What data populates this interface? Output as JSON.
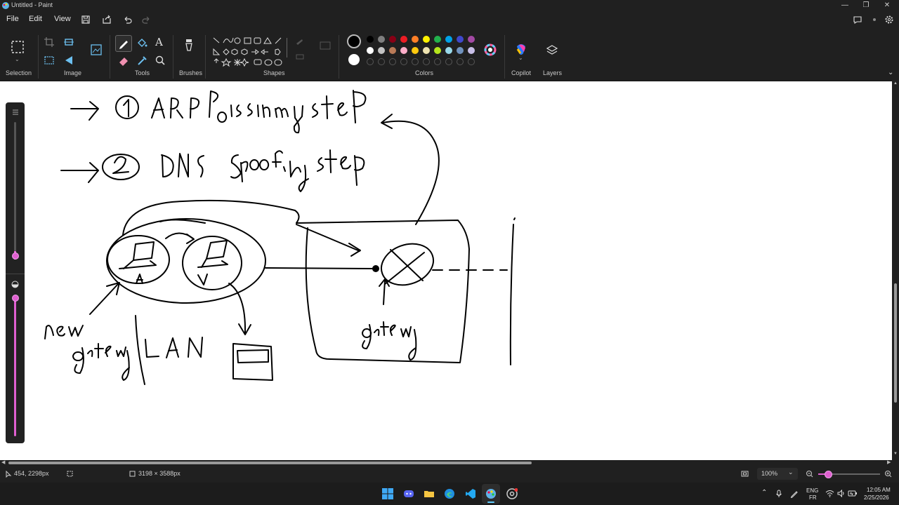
{
  "window": {
    "title": "Untitled - Paint",
    "controls": [
      "minimize-icon",
      "restore-icon",
      "close-icon"
    ]
  },
  "menu": {
    "items": [
      "File",
      "Edit",
      "View"
    ],
    "quick_actions": [
      "save-icon",
      "share-icon",
      "undo-icon",
      "redo-icon"
    ],
    "right_icons": [
      "feedback-icon",
      "account-icon",
      "settings-icon"
    ]
  },
  "ribbon": {
    "groups": {
      "selection": "Selection",
      "image": "Image",
      "tools": "Tools",
      "brushes": "Brushes",
      "shapes": "Shapes",
      "colors": "Colors",
      "copilot": "Copilot",
      "layers": "Layers"
    },
    "colors": {
      "primary": "#000000",
      "secondary": "#ffffff",
      "palette_row1": [
        "#000000",
        "#7f7f7f",
        "#880015",
        "#ed1c24",
        "#ff7f27",
        "#fff200",
        "#22b14c",
        "#00a2e8",
        "#3f48cc",
        "#a349a4"
      ],
      "palette_row2": [
        "#ffffff",
        "#c3c3c3",
        "#b97a57",
        "#ffaec9",
        "#ffc90e",
        "#efe4b0",
        "#b5e61d",
        "#99d9ea",
        "#7092be",
        "#c8bfe7"
      ],
      "accent": "#e05fd0"
    }
  },
  "status": {
    "cursor_position": "454, 2298px",
    "canvas_size": "3198 × 3588px",
    "zoom": "100%"
  },
  "taskbar": {
    "apps": [
      "windows-start-icon",
      "discord-icon",
      "file-explorer-icon",
      "edge-icon",
      "vscode-icon",
      "paint-icon",
      "chrome-icon"
    ],
    "language": "ENG",
    "layout": "FR",
    "time": "12:05 AM",
    "date": "2/25/2026"
  },
  "drawing": {
    "text_1": "→ ① ARP Poissning steP",
    "text_2": "→ ② DNS Spoofing step",
    "label_new_gateway": "New gateway",
    "label_lan": "LAN",
    "label_gateway": "gateway",
    "label_a": "A",
    "label_v": "V"
  }
}
